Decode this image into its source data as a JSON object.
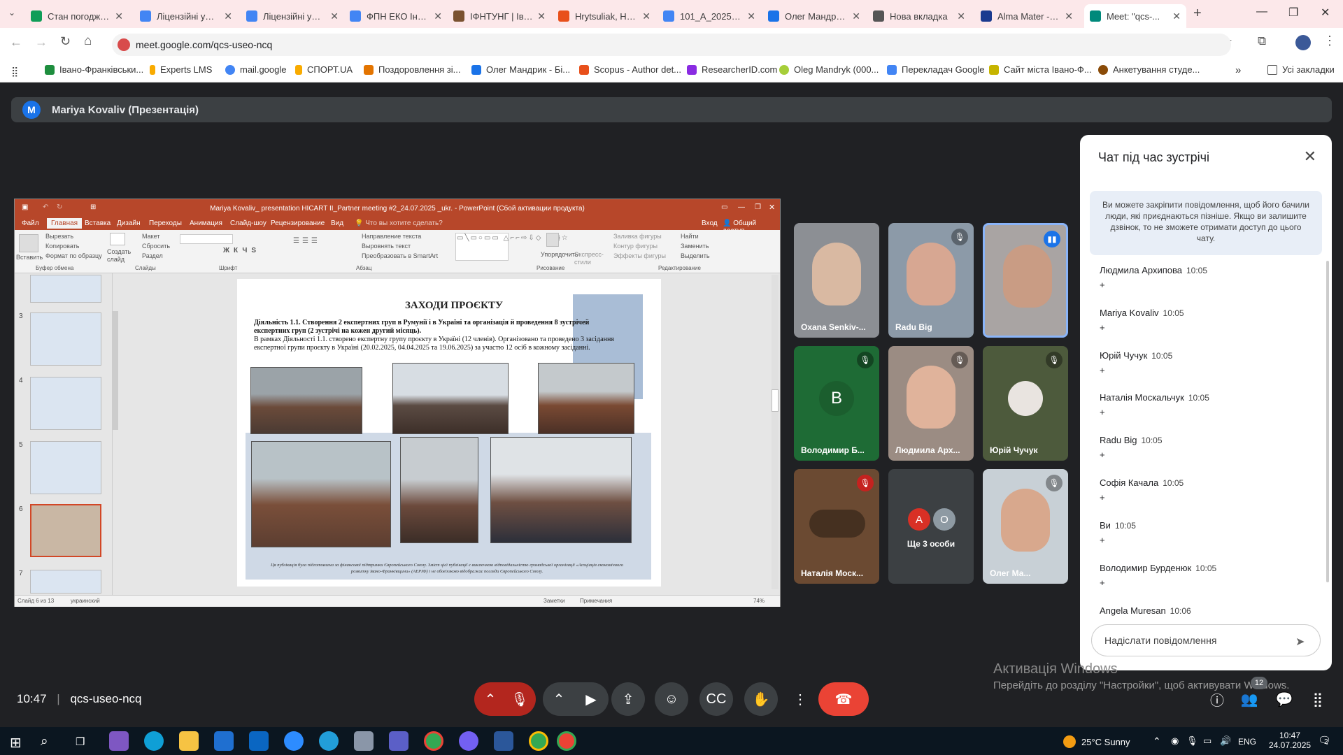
{
  "tabs": [
    {
      "title": "Стан погодже...",
      "color": "#0f9d58"
    },
    {
      "title": "Ліцензійні умо...",
      "color": "#4285f4"
    },
    {
      "title": "Ліцензійні умо...",
      "color": "#4285f4"
    },
    {
      "title": "ФПН ЕКО Інфо...",
      "color": "#4285f4"
    },
    {
      "title": "ІФНТУНГ | Іван...",
      "color": "#7a5230"
    },
    {
      "title": "Hrytsuliak, H. M...",
      "color": "#e8501b"
    },
    {
      "title": "101_А_2025 О...",
      "color": "#4285f4"
    },
    {
      "title": "Олег Мандрик...",
      "color": "#1a73e8"
    },
    {
      "title": "Нова вкладка",
      "color": "#555"
    },
    {
      "title": "Alma Mater - І...",
      "color": "#1a3a8f"
    },
    {
      "title": "Meet: \"qcs-...",
      "color": "#00897b"
    }
  ],
  "url": "meet.google.com/qcs-useo-ncq",
  "bookmarks": [
    "Івано-Франківськи...",
    "Experts LMS",
    "mail.google",
    "СПОРТ.UA",
    "Поздоровлення зі...",
    "Олег Мандрик - Бі...",
    "Scopus - Author det...",
    "ResearcherID.com",
    "Oleg Mandryk (000...",
    "Перекладач Google",
    "Сайт міста Івано-Ф...",
    "Анкетування студе..."
  ],
  "bookmarks_all": "Усі закладки",
  "presenter": {
    "initial": "M",
    "name": "Mariya Kovaliv (Презентація)"
  },
  "ppt": {
    "title": "Mariya Kovaliv_ presentation HICART II_Partner meeting #2_24.07.2025 _ukr. - PowerPoint (Сбой активации продукта)",
    "tabs": [
      "Файл",
      "Главная",
      "Вставка",
      "Дизайн",
      "Переходы",
      "Анимация",
      "Слайд-шоу",
      "Рецензирование",
      "Вид",
      "Что вы хотите сделать?"
    ],
    "login": "Вход",
    "share": "Общий доступ",
    "ribbon": {
      "cut": "Вырезать",
      "copy": "Копировать",
      "format": "Формат по образцу",
      "paste": "Вставить",
      "clipboard": "Буфер обмена",
      "new_slide": "Создать слайд",
      "layout": "Макет",
      "reset": "Сбросить",
      "section": "Раздел",
      "slides": "Слайды",
      "font": "Шрифт",
      "paragraph": "Абзац",
      "text_dir": "Направление текста",
      "align_text": "Выровнять текст",
      "smartart": "Преобразовать в SmartArt",
      "arrange": "Упорядочить",
      "express": "Экспресс-стили",
      "fill": "Заливка фигуры",
      "outline": "Контур фигуры",
      "effects": "Эффекты фигуры",
      "drawing": "Рисование",
      "find": "Найти",
      "replace": "Заменить",
      "select": "Выделить",
      "editing": "Редактирование"
    },
    "slide_numbers": [
      "3",
      "4",
      "5",
      "6",
      "7"
    ],
    "status_left": "Слайд 6 из 13",
    "status_lang": "украинский",
    "notes": "Заметки",
    "comments": "Примечания",
    "zoom": "74%"
  },
  "slide": {
    "title": "ЗАХОДИ ПРОЄКТУ",
    "heading": "Діяльність 1.1. Створення 2 експертних груп в Румунії і в Україні та організація й проведення 8 зустрічей експертних груп (2 зустрічі на кожен другий місяць).",
    "body": "В рамках Діяльності 1.1. створено експертну групу проєкту в Україні (12 членів). Організовано та проведено 3 засідання експертної групи проєкту в Україні (20.02.2025, 04.04.2025 та 19.06.2025) за участю 12 осіб в кожному засіданні.",
    "footer": "Ця публікація була підготовлена за фінансової підтримки Європейського Союзу. Зміст цієї публікації є виключною відповідальністю громадської організації «Асоціація економічного розвитку Івано-Франківщини» (АЕРІФ) і не обов'язково відображає погляди Європейського Союзу."
  },
  "participants": [
    {
      "name": "Oxana Senkiv-...",
      "muted": false
    },
    {
      "name": "Radu Big",
      "muted": true
    },
    {
      "name": "",
      "muted": false,
      "speaking": true
    },
    {
      "name": "Володимир Б...",
      "muted": true,
      "initial": "B"
    },
    {
      "name": "Людмила Арх...",
      "muted": true
    },
    {
      "name": "Юрій Чучук",
      "muted": true
    },
    {
      "name": "Наталія Моск...",
      "muted": true
    },
    {
      "name": "Ще 3 особи",
      "initials": [
        "A",
        "O"
      ]
    },
    {
      "name": "Олег Ма...",
      "muted": true
    }
  ],
  "chat": {
    "title": "Чат під час зустрічі",
    "info": "Ви можете закріпити повідомлення, щоб його бачили люди, які приєднаються пізніше. Якщо ви залишите дзвінок, то не зможете отримати доступ до цього чату.",
    "messages": [
      {
        "author": "Людмила Архипова",
        "time": "10:05",
        "text": "+"
      },
      {
        "author": "Mariya Kovaliv",
        "time": "10:05",
        "text": "+"
      },
      {
        "author": "Юрій Чучук",
        "time": "10:05",
        "text": "+"
      },
      {
        "author": "Наталія Москальчук",
        "time": "10:05",
        "text": "+"
      },
      {
        "author": "Radu Big",
        "time": "10:05",
        "text": "+"
      },
      {
        "author": "Софія Качала",
        "time": "10:05",
        "text": "+"
      },
      {
        "author": "Ви",
        "time": "10:05",
        "text": "+"
      },
      {
        "author": "Володимир Бурденюк",
        "time": "10:05",
        "text": "+"
      },
      {
        "author": "Angela Muresan",
        "time": "10:06",
        "text": ""
      }
    ],
    "placeholder": "Надіслати повідомлення"
  },
  "activation": {
    "line1": "Активація Windows",
    "line2": "Перейдіть до розділу \"Настройки\", щоб активувати Windows."
  },
  "meeting": {
    "time": "10:47",
    "code": "qcs-useo-ncq",
    "people_count": "12"
  },
  "taskbar": {
    "weather": "25°C  Sunny",
    "lang": "ENG",
    "time": "10:47",
    "date": "24.07.2025",
    "notif": "2"
  }
}
